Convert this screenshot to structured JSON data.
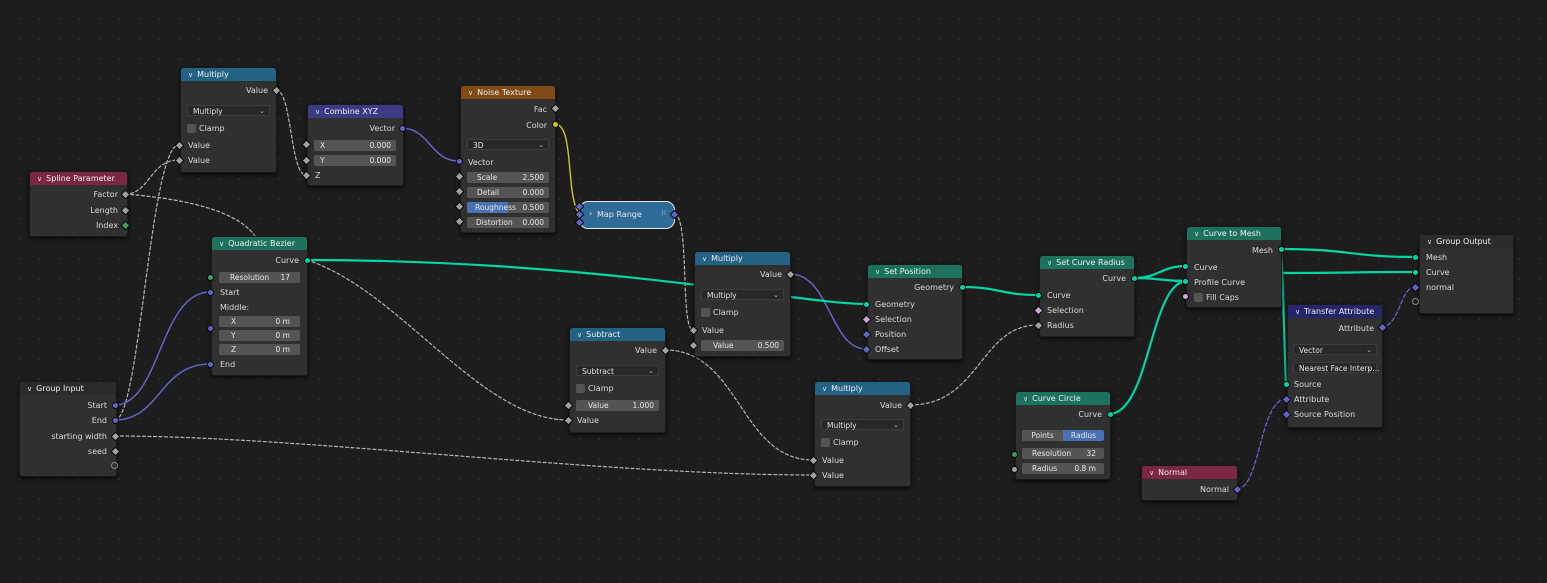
{
  "nodes": {
    "multiply1": {
      "title": "Multiply",
      "output": "Value",
      "op": "Multiply",
      "clamp": "Clamp",
      "in1": "Value",
      "in2": "Value"
    },
    "combine": {
      "title": "Combine XYZ",
      "output": "Vector",
      "x_label": "X",
      "x_val": "0.000",
      "y_label": "Y",
      "y_val": "0.000",
      "z_label": "Z"
    },
    "noise": {
      "title": "Noise Texture",
      "out_fac": "Fac",
      "out_color": "Color",
      "dim": "3D",
      "vector": "Vector",
      "scale_label": "Scale",
      "scale_val": "2.500",
      "detail_label": "Detail",
      "detail_val": "0.000",
      "rough_label": "Roughness",
      "rough_val": "0.500",
      "dist_label": "Distortion",
      "dist_val": "0.000"
    },
    "spline": {
      "title": "Spline Parameter",
      "factor": "Factor",
      "length": "Length",
      "index": "Index"
    },
    "maprange": {
      "title": "Map Range"
    },
    "bezier": {
      "title": "Quadratic Bezier",
      "output": "Curve",
      "res_label": "Resolution",
      "res_val": "17",
      "start": "Start",
      "middle": "Middle:",
      "x_label": "X",
      "x_val": "0 m",
      "y_label": "Y",
      "y_val": "0 m",
      "z_label": "Z",
      "z_val": "0 m",
      "end": "End"
    },
    "groupin": {
      "title": "Group Input",
      "start": "Start",
      "end": "End",
      "width": "starting width",
      "seed": "seed"
    },
    "multiply2": {
      "title": "Multiply",
      "output": "Value",
      "op": "Multiply",
      "clamp": "Clamp",
      "in1": "Value",
      "val_label": "Value",
      "val": "0.500"
    },
    "subtract": {
      "title": "Subtract",
      "output": "Value",
      "op": "Subtract",
      "clamp": "Clamp",
      "val_label": "Value",
      "val": "1.000",
      "in2": "Value"
    },
    "setpos": {
      "title": "Set Position",
      "output": "Geometry",
      "in_geo": "Geometry",
      "selection": "Selection",
      "position": "Position",
      "offset": "Offset"
    },
    "multiply3": {
      "title": "Multiply",
      "output": "Value",
      "op": "Multiply",
      "clamp": "Clamp",
      "in1": "Value",
      "in2": "Value"
    },
    "setradius": {
      "title": "Set Curve Radius",
      "output": "Curve",
      "in_curve": "Curve",
      "selection": "Selection",
      "radius": "Radius"
    },
    "circle": {
      "title": "Curve Circle",
      "output": "Curve",
      "mode_points": "Points",
      "mode_radius": "Radius",
      "res_label": "Resolution",
      "res_val": "32",
      "rad_label": "Radius",
      "rad_val": "0.8 m"
    },
    "tomesh": {
      "title": "Curve to Mesh",
      "output": "Mesh",
      "curve": "Curve",
      "profile": "Profile Curve",
      "fill": "Fill Caps"
    },
    "transfer": {
      "title": "Transfer Attribute",
      "output": "Attribute",
      "dtype": "Vector",
      "mapping": "Nearest Face Interp...",
      "source": "Source",
      "attribute": "Attribute",
      "source_pos": "Source Position"
    },
    "normal": {
      "title": "Normal",
      "output": "Normal"
    },
    "groupout": {
      "title": "Group Output",
      "mesh": "Mesh",
      "curve": "Curve",
      "normal": "normal"
    }
  },
  "colors": {
    "geometry": "#00d6a3",
    "vector": "#6363c7",
    "float": "#a1a1a1",
    "color": "#c7c729",
    "math_header": "#246283",
    "geo_header": "#1d725e",
    "texture_header": "#7f4c15",
    "input_header": "#7c2741"
  },
  "icons": {
    "collapse": "chevron-down-icon"
  }
}
